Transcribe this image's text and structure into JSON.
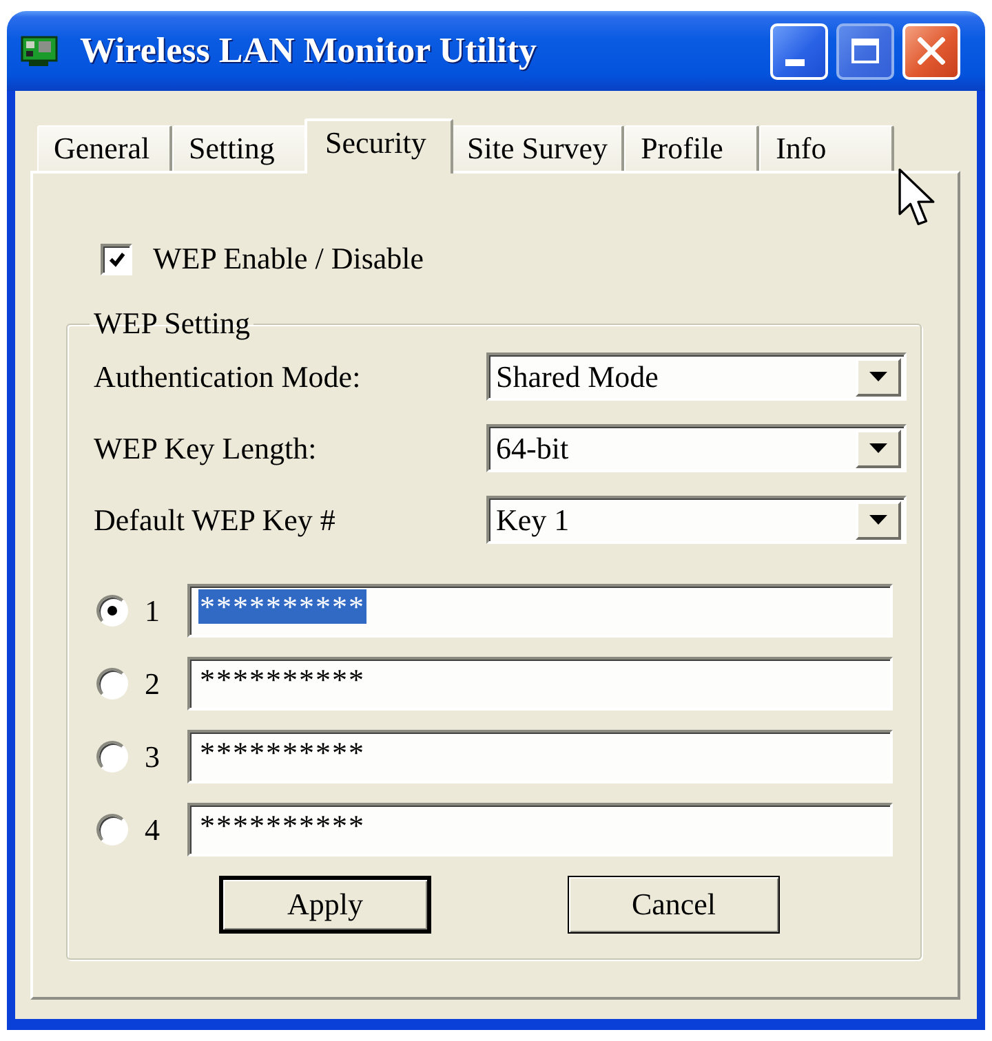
{
  "window": {
    "title": "Wireless LAN Monitor Utility",
    "maximize_disabled": true
  },
  "tabs": [
    {
      "label": "General",
      "selected": false
    },
    {
      "label": "Setting",
      "selected": false
    },
    {
      "label": "Security",
      "selected": true
    },
    {
      "label": "Site Survey",
      "selected": false
    },
    {
      "label": "Profile",
      "selected": false
    },
    {
      "label": "Info",
      "selected": false
    }
  ],
  "wep_enable": {
    "label": "WEP Enable / Disable",
    "checked": true
  },
  "wep_setting": {
    "title": "WEP Setting",
    "fields": [
      {
        "label": "Authentication Mode:",
        "value": "Shared Mode"
      },
      {
        "label": "WEP Key Length:",
        "value": "64-bit"
      },
      {
        "label": "Default WEP Key #",
        "value": "Key 1"
      }
    ],
    "keys": [
      {
        "label": "1",
        "selected": true,
        "value": "**********",
        "text_selected": true
      },
      {
        "label": "2",
        "selected": false,
        "value": "**********",
        "text_selected": false
      },
      {
        "label": "3",
        "selected": false,
        "value": "**********",
        "text_selected": false
      },
      {
        "label": "4",
        "selected": false,
        "value": "**********",
        "text_selected": false
      }
    ]
  },
  "buttons": [
    {
      "label": "Apply",
      "default": true
    },
    {
      "label": "Cancel",
      "default": false
    }
  ]
}
